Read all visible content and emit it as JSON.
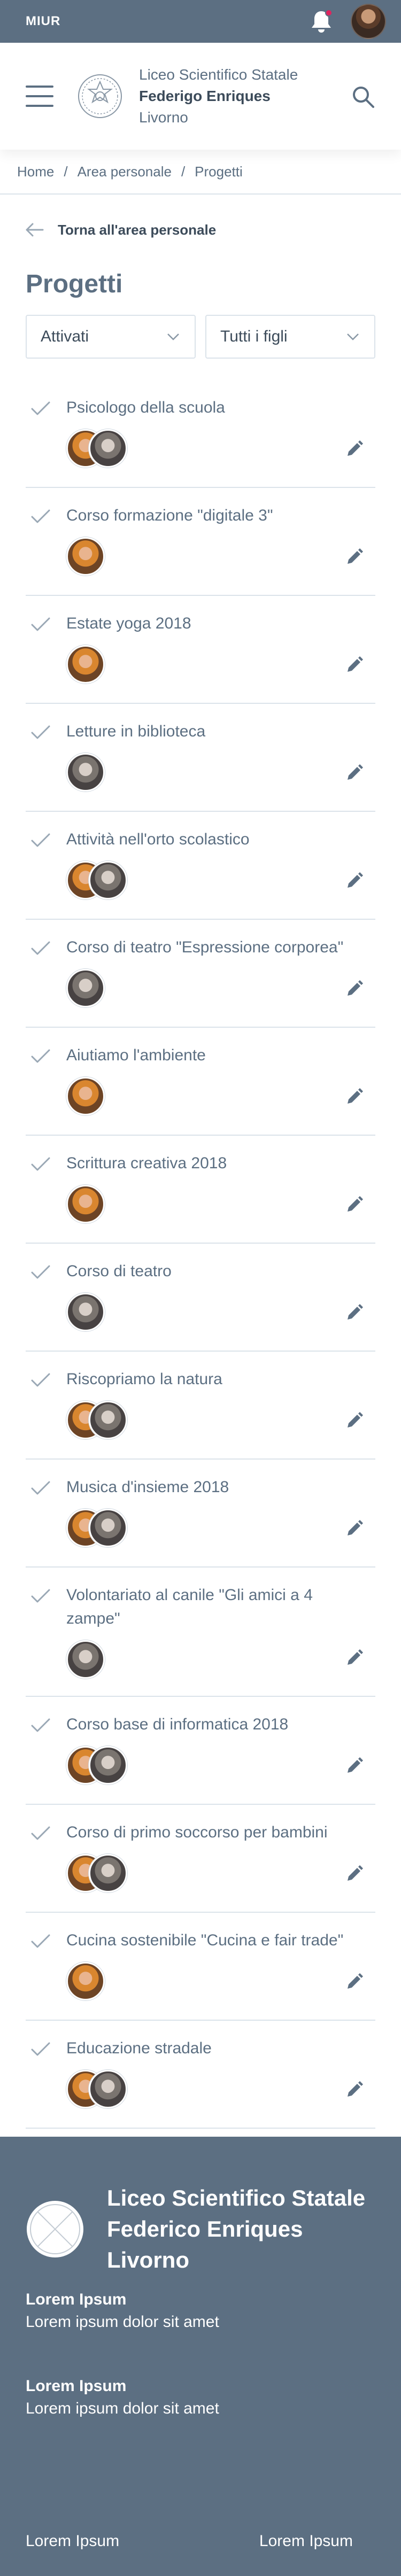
{
  "topbar": {
    "brand": "MIUR",
    "notification_icon": "bell-icon",
    "notification_color": "#e0245e"
  },
  "header": {
    "menu_icon": "hamburger-icon",
    "school_line1": "Liceo Scientifico Statale",
    "school_name": "Federigo Enriques",
    "school_city": "Livorno",
    "search_icon": "search-icon"
  },
  "breadcrumb": [
    "Home",
    "Area personale",
    "Progetti"
  ],
  "back_label": "Torna all'area personale",
  "page_title": "Progetti",
  "filters": {
    "status": "Attivati",
    "children": "Tutti i figli"
  },
  "projects": [
    {
      "title": "Psicologo della scuola",
      "avatars": [
        "a1",
        "a2"
      ]
    },
    {
      "title": "Corso formazione \"digitale 3\"",
      "avatars": [
        "a1"
      ]
    },
    {
      "title": "Estate yoga 2018",
      "avatars": [
        "a1"
      ]
    },
    {
      "title": "Letture in biblioteca",
      "avatars": [
        "a2"
      ]
    },
    {
      "title": "Attività nell'orto scolastico",
      "avatars": [
        "a1",
        "a2"
      ]
    },
    {
      "title": "Corso di teatro \"Espressione corporea\"",
      "avatars": [
        "a2"
      ]
    },
    {
      "title": "Aiutiamo l'ambiente",
      "avatars": [
        "a1"
      ]
    },
    {
      "title": "Scrittura creativa 2018",
      "avatars": [
        "a1"
      ]
    },
    {
      "title": "Corso di teatro",
      "avatars": [
        "a2"
      ]
    },
    {
      "title": "Riscopriamo la natura",
      "avatars": [
        "a1",
        "a2"
      ]
    },
    {
      "title": "Musica d'insieme 2018",
      "avatars": [
        "a1",
        "a2"
      ]
    },
    {
      "title": "Volontariato al canile \"Gli amici a 4 zampe\"",
      "avatars": [
        "a2"
      ]
    },
    {
      "title": "Corso base di informatica 2018",
      "avatars": [
        "a1",
        "a2"
      ]
    },
    {
      "title": "Corso di primo soccorso per bambini",
      "avatars": [
        "a1",
        "a2"
      ]
    },
    {
      "title": "Cucina sostenibile \"Cucina e fair trade\"",
      "avatars": [
        "a1"
      ]
    },
    {
      "title": "Educazione stradale",
      "avatars": [
        "a1",
        "a2"
      ]
    }
  ],
  "footer": {
    "name_line1": "Liceo Scientifico Statale",
    "name_line2": "Federico Enriques",
    "name_line3": "Livorno",
    "blocks": [
      {
        "heading": "Lorem Ipsum",
        "text": "Lorem ipsum dolor sit amet"
      },
      {
        "heading": "Lorem Ipsum",
        "text": "Lorem ipsum dolor sit amet"
      }
    ],
    "bottom_left": "Lorem Ipsum",
    "bottom_right": "Lorem Ipsum"
  }
}
